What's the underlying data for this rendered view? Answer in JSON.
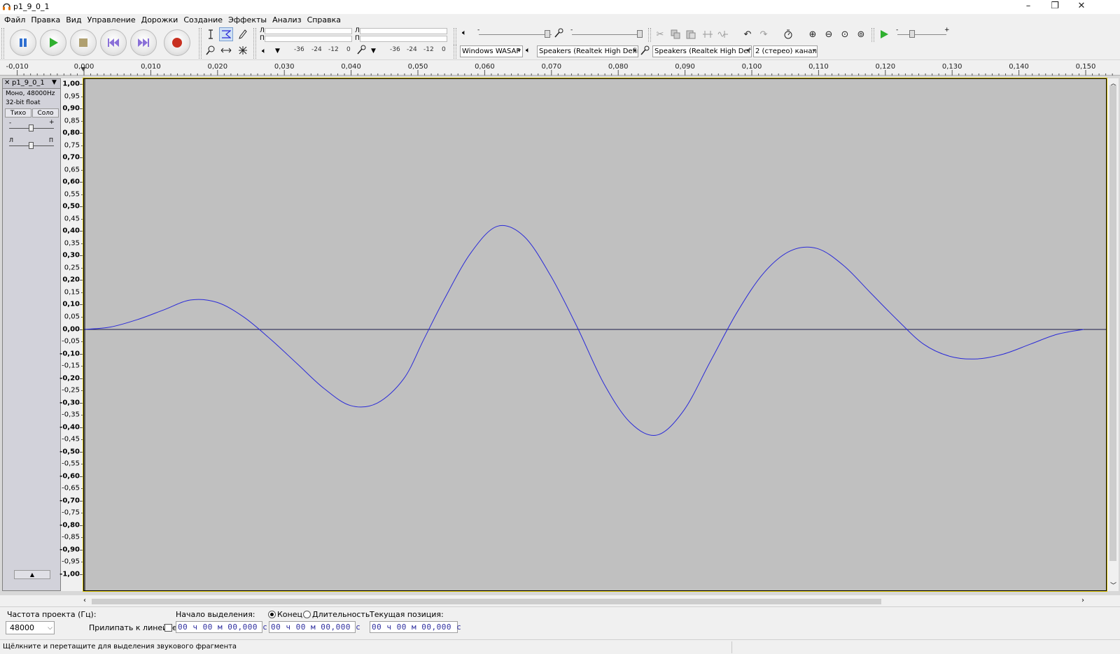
{
  "window": {
    "title": "p1_9_0_1",
    "minimize": "–",
    "restore": "❐",
    "close": "✕"
  },
  "menu": [
    "Файл",
    "Правка",
    "Вид",
    "Управление",
    "Дорожки",
    "Создание",
    "Эффекты",
    "Анализ",
    "Справка"
  ],
  "meters": {
    "left_label": "Л",
    "right_label": "П",
    "play_scale": [
      "-36",
      "-24",
      "-12",
      "0"
    ],
    "rec_scale": [
      "-36",
      "-24",
      "-12",
      "0"
    ]
  },
  "mixer": {
    "minus": "-",
    "plus": "+"
  },
  "devices": {
    "host": "Windows WASAP",
    "playback": "Speakers (Realtek High Definit",
    "recording": "Speakers (Realtek High Definit",
    "channels": "2 (стерео) канал"
  },
  "ruler_labels": [
    "-0,010",
    "0,000",
    "0,010",
    "0,020",
    "0,030",
    "0,040",
    "0,050",
    "0,060",
    "0,070",
    "0,080",
    "0,090",
    "0,100",
    "0,110",
    "0,120",
    "0,130",
    "0,140",
    "0,150"
  ],
  "track": {
    "name": "p1_9_0_1",
    "format": "Моно, 48000Hz",
    "bitdepth": "32-bit float",
    "mute": "Тихо",
    "solo": "Соло",
    "gain_minus": "-",
    "gain_plus": "+",
    "pan_left": "Л",
    "pan_right": "П",
    "collapse": "▲"
  },
  "amplitude_labels": [
    "1,00",
    "0,95",
    "0,90",
    "0,85",
    "0,80",
    "0,75",
    "0,70",
    "0,65",
    "0,60",
    "0,55",
    "0,50",
    "0,45",
    "0,40",
    "0,35",
    "0,30",
    "0,25",
    "0,20",
    "0,15",
    "0,10",
    "0,05",
    "0,00",
    "-0,05",
    "-0,10",
    "-0,15",
    "-0,20",
    "-0,25",
    "-0,30",
    "-0,35",
    "-0,40",
    "-0,45",
    "-0,50",
    "-0,55",
    "-0,60",
    "-0,65",
    "-0,70",
    "-0,75",
    "-0,80",
    "-0,85",
    "-0,90",
    "-0,95",
    "-1,00"
  ],
  "waveform": {
    "color": "#2a2ad8",
    "x_range_s": [
      0.0,
      0.15
    ],
    "y_range": [
      -1.0,
      1.0
    ],
    "points": [
      [
        0.0,
        0.0
      ],
      [
        0.004,
        0.01
      ],
      [
        0.008,
        0.04
      ],
      [
        0.012,
        0.08
      ],
      [
        0.016,
        0.12
      ],
      [
        0.02,
        0.11
      ],
      [
        0.024,
        0.05
      ],
      [
        0.028,
        -0.04
      ],
      [
        0.032,
        -0.14
      ],
      [
        0.036,
        -0.24
      ],
      [
        0.04,
        -0.31
      ],
      [
        0.044,
        -0.3
      ],
      [
        0.048,
        -0.2
      ],
      [
        0.051,
        -0.04
      ],
      [
        0.054,
        0.12
      ],
      [
        0.058,
        0.31
      ],
      [
        0.062,
        0.42
      ],
      [
        0.066,
        0.38
      ],
      [
        0.07,
        0.22
      ],
      [
        0.074,
        0.01
      ],
      [
        0.078,
        -0.22
      ],
      [
        0.082,
        -0.38
      ],
      [
        0.086,
        -0.43
      ],
      [
        0.09,
        -0.33
      ],
      [
        0.094,
        -0.13
      ],
      [
        0.098,
        0.07
      ],
      [
        0.102,
        0.23
      ],
      [
        0.106,
        0.32
      ],
      [
        0.11,
        0.33
      ],
      [
        0.114,
        0.26
      ],
      [
        0.118,
        0.15
      ],
      [
        0.122,
        0.04
      ],
      [
        0.126,
        -0.06
      ],
      [
        0.13,
        -0.11
      ],
      [
        0.134,
        -0.12
      ],
      [
        0.138,
        -0.1
      ],
      [
        0.142,
        -0.06
      ],
      [
        0.146,
        -0.02
      ],
      [
        0.15,
        0.0
      ]
    ]
  },
  "selection": {
    "project_rate_label": "Частота проекта (Гц):",
    "project_rate": "48000",
    "snap_label": "Прилипать к линейке",
    "sel_start_label": "Начало выделения:",
    "end_label": "Конец",
    "length_label": "Длительность",
    "position_label": "Текущая позиция:",
    "start_time": "00 ч 00 м 00,000 с",
    "end_time": "00 ч 00 м 00,000 с",
    "pos_time": "00 ч 00 м 00,000 с"
  },
  "status": "Щёлкните и перетащите для выделения звукового фрагмента"
}
